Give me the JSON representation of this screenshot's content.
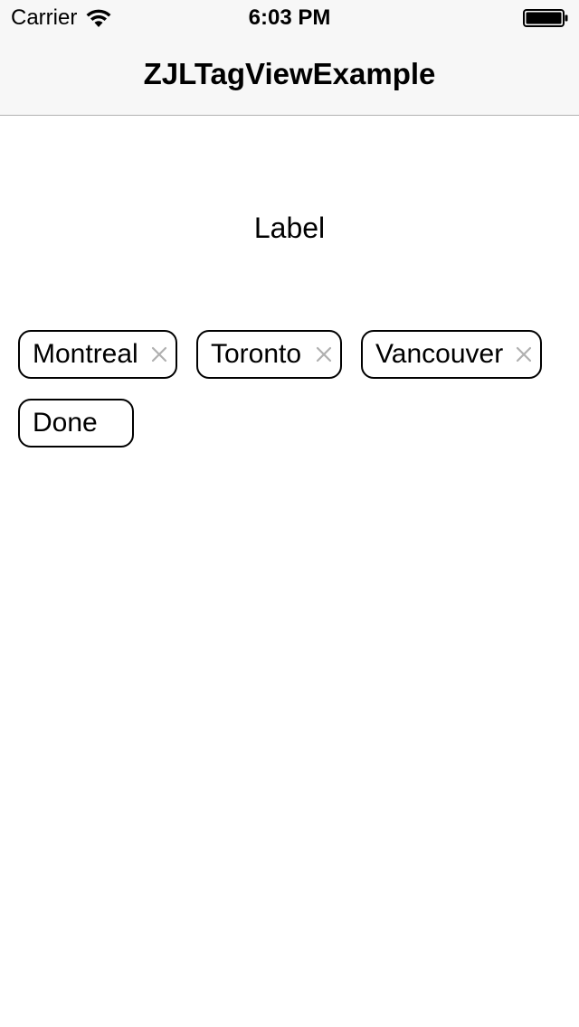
{
  "status_bar": {
    "carrier": "Carrier",
    "time": "6:03 PM",
    "wifi_icon": "wifi-icon",
    "battery_icon": "battery-icon"
  },
  "nav_bar": {
    "title": "ZJLTagView​Example"
  },
  "main": {
    "label": "Label",
    "tags": [
      {
        "label": "Montreal",
        "removable": true,
        "close_icon": "close-icon"
      },
      {
        "label": "Toronto",
        "removable": true,
        "close_icon": "close-icon"
      },
      {
        "label": "Vancouver",
        "removable": true,
        "close_icon": "close-icon"
      },
      {
        "label": "Done",
        "removable": false
      }
    ]
  },
  "colors": {
    "bar_background": "#f7f7f7",
    "nav_separator": "#b2b2b2",
    "tag_border": "#000000",
    "close_icon": "#b0b0b0"
  }
}
